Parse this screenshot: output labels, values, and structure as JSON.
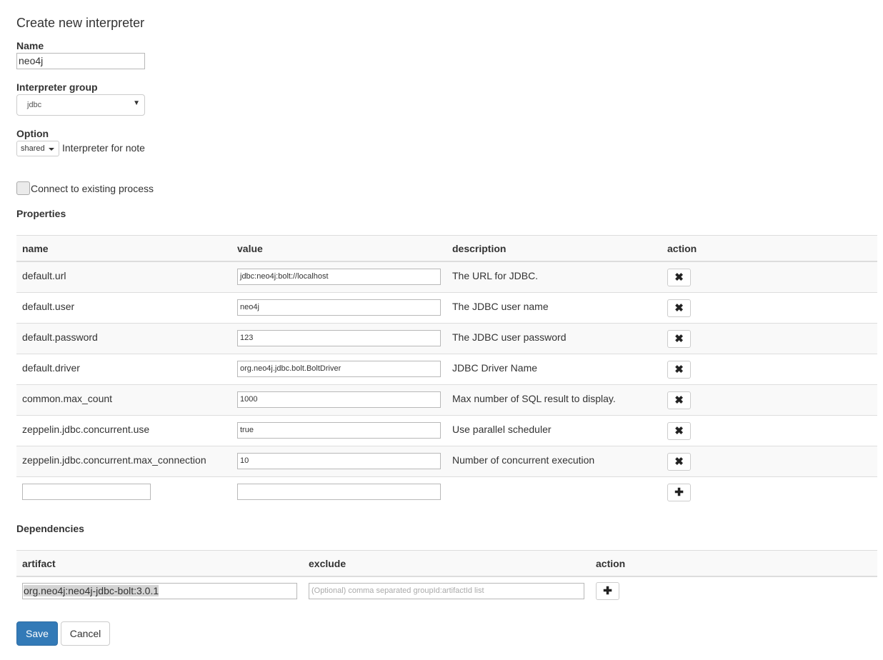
{
  "page": {
    "title": "Create new interpreter"
  },
  "name_field": {
    "label": "Name",
    "value": "neo4j"
  },
  "group_field": {
    "label": "Interpreter group",
    "selected": "jdbc"
  },
  "option": {
    "label": "Option",
    "mode": "shared",
    "suffix": "Interpreter for note"
  },
  "connect": {
    "label": "Connect to existing process",
    "checked": false
  },
  "properties": {
    "label": "Properties",
    "columns": [
      "name",
      "value",
      "description",
      "action"
    ],
    "rows": [
      {
        "name": "default.url",
        "value": "jdbc:neo4j:bolt://localhost",
        "description": "The URL for JDBC."
      },
      {
        "name": "default.user",
        "value": "neo4j",
        "description": "The JDBC user name"
      },
      {
        "name": "default.password",
        "value": "123",
        "description": "The JDBC user password"
      },
      {
        "name": "default.driver",
        "value": "org.neo4j.jdbc.bolt.BoltDriver",
        "description": "JDBC Driver Name"
      },
      {
        "name": "common.max_count",
        "value": "1000",
        "description": "Max number of SQL result to display."
      },
      {
        "name": "zeppelin.jdbc.concurrent.use",
        "value": "true",
        "description": "Use parallel scheduler"
      },
      {
        "name": "zeppelin.jdbc.concurrent.max_connection",
        "value": "10",
        "description": "Number of concurrent execution"
      }
    ],
    "remove_icon": "remove-icon",
    "add_icon": "plus-icon"
  },
  "dependencies": {
    "label": "Dependencies",
    "columns": [
      "artifact",
      "exclude",
      "action"
    ],
    "artifact_value": "org.neo4j:neo4j-jdbc-bolt:3.0.1",
    "exclude_placeholder": "(Optional) comma separated groupId:artifactId list"
  },
  "buttons": {
    "save": "Save",
    "cancel": "Cancel"
  },
  "colors": {
    "primary": "#337ab7",
    "border": "#dddddd",
    "stripe": "#f9f9f9"
  }
}
